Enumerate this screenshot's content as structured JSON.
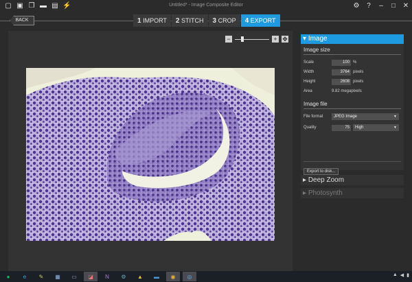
{
  "window": {
    "title": "Untitled* - Image Composite Editor",
    "toolbar_icons": [
      "new-project-icon",
      "new-panorama-icon",
      "copy-icon",
      "open-folder-icon",
      "save-icon",
      "adjust-icon"
    ],
    "controls": [
      "⚙",
      "?",
      "–",
      "□",
      "✕"
    ]
  },
  "nav": {
    "back_label": "BACK",
    "steps": [
      {
        "num": "1",
        "label": "IMPORT"
      },
      {
        "num": "2",
        "label": "STITCH"
      },
      {
        "num": "3",
        "label": "CROP"
      },
      {
        "num": "4",
        "label": "EXPORT",
        "active": true
      }
    ]
  },
  "zoom": {
    "minus": "−",
    "plus": "+",
    "fit": "✥",
    "level": 0.2
  },
  "panel": {
    "image_section": "Image",
    "image_size": {
      "title": "Image size",
      "scale_label": "Scale",
      "scale_value": "100",
      "scale_unit": "%",
      "width_label": "Width",
      "width_value": "3764",
      "width_unit": "pixels",
      "height_label": "Height",
      "height_value": "2608",
      "height_unit": "pixels",
      "area_label": "Area",
      "area_value": "9.82 megapixels"
    },
    "image_file": {
      "title": "Image file",
      "format_label": "File format",
      "format_value": "JPEG Image",
      "quality_label": "Quality",
      "quality_value": "75",
      "quality_level": "High"
    },
    "export_button": "Export to disk...",
    "deep_zoom": "Deep Zoom",
    "photosynth": "Photosynth"
  },
  "taskbar": {
    "apps": [
      "spotify-icon",
      "ie-icon",
      "paint-icon",
      "explorer-icon",
      "computer-icon",
      "photos-icon",
      "onenote-icon",
      "settings-icon",
      "drive-icon",
      "folder-icon",
      "chrome-icon",
      "ice-icon"
    ],
    "tray": [
      "▲",
      "◀",
      "▮"
    ]
  },
  "colors": {
    "accent": "#1e9be0",
    "background": "#2b2b2b",
    "stain": "#6b4fa8",
    "tissue_bg": "#eef0dc"
  }
}
